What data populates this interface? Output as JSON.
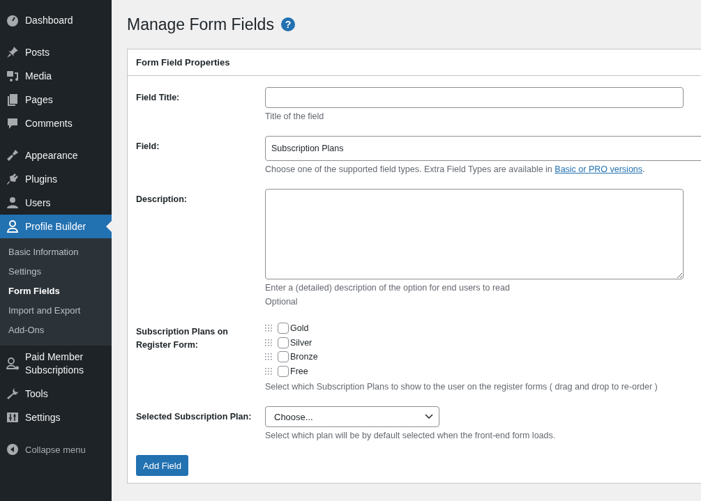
{
  "sidebar": {
    "groups": [
      [
        {
          "label": "Dashboard",
          "selected": false
        }
      ],
      [
        {
          "label": "Posts",
          "selected": false
        },
        {
          "label": "Media",
          "selected": false
        },
        {
          "label": "Pages",
          "selected": false
        },
        {
          "label": "Comments",
          "selected": false
        }
      ],
      [
        {
          "label": "Appearance",
          "selected": false
        },
        {
          "label": "Plugins",
          "selected": false
        },
        {
          "label": "Users",
          "selected": false
        },
        {
          "label": "Profile Builder",
          "selected": true,
          "submenu": [
            {
              "label": "Basic Information",
              "selected": false
            },
            {
              "label": "Settings",
              "selected": false
            },
            {
              "label": "Form Fields",
              "selected": true
            },
            {
              "label": "Import and Export",
              "selected": false
            },
            {
              "label": "Add-Ons",
              "selected": false
            }
          ]
        },
        {
          "label": "Paid Member Subscriptions",
          "selected": false
        },
        {
          "label": "Tools",
          "selected": false
        },
        {
          "label": "Settings",
          "selected": false
        }
      ]
    ],
    "collapse": "Collapse menu"
  },
  "page": {
    "title": "Manage Form Fields",
    "help": "?"
  },
  "panel": {
    "title": "Form Field Properties",
    "rows": [
      {
        "kind": "text",
        "label": "Field Title:",
        "value": "",
        "hints": [
          {
            "text": "Title of the field"
          }
        ]
      },
      {
        "kind": "select",
        "label": "Field:",
        "value": "Subscription Plans",
        "hints": [
          {
            "text": "Choose one of the supported field types. Extra Field Types are available in ",
            "link": "Basic or PRO versions",
            "after": "."
          }
        ]
      },
      {
        "kind": "textarea",
        "label": "Description:",
        "value": "",
        "hints": [
          {
            "text": "Enter a (detailed) description of the option for end users to read"
          },
          {
            "text": "Optional"
          }
        ]
      },
      {
        "kind": "checklist",
        "label": "Subscription Plans on Register Form:",
        "options": [
          {
            "label": "Gold",
            "checked": false
          },
          {
            "label": "Silver",
            "checked": false
          },
          {
            "label": "Bronze",
            "checked": false
          },
          {
            "label": "Free",
            "checked": false
          }
        ],
        "hints": [
          {
            "text": "Select which Subscription Plans to show to the user on the register forms ( drag and drop to re-order )"
          }
        ]
      },
      {
        "kind": "dropdown",
        "label": "Selected Subscription Plan:",
        "value": "Choose...",
        "hints": [
          {
            "text": "Select which plan will be by default selected when the front-end form loads."
          }
        ]
      }
    ],
    "button": "Add Field"
  }
}
